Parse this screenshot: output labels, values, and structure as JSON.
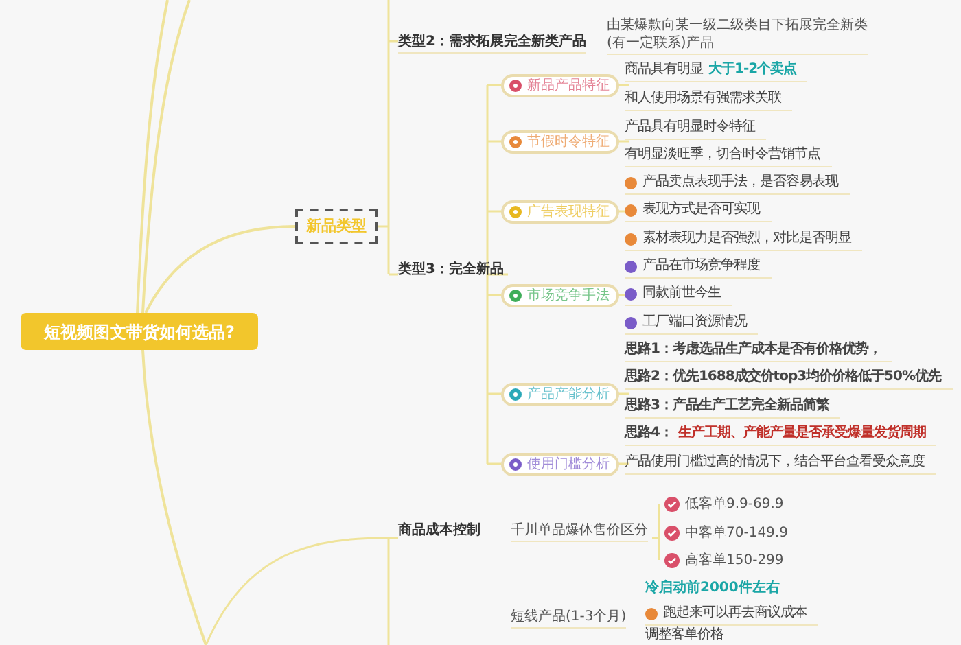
{
  "root": "短视频图文带货如何选品?",
  "new_products": {
    "label": "新品类型",
    "type2": {
      "label": "类型2：需求拓展完全新类产品",
      "note": "由某爆款向某一级二级类目下拓展完全新类(有一定联系)产品"
    },
    "type3": {
      "label": "类型3：完全新品",
      "features": [
        {
          "label": "新品产品特征",
          "color": "#d9506a",
          "items": [
            {
              "kind": "accent",
              "text": "商品具有明显",
              "highlight": "大于1-2个卖点"
            },
            {
              "kind": "plain",
              "text": "和人使用场景有强需求关联"
            }
          ]
        },
        {
          "label": "节假时令特征",
          "color": "#e8893a",
          "items": [
            {
              "kind": "plain",
              "text": "产品具有明显时令特征"
            },
            {
              "kind": "plain",
              "text": "有明显淡旺季，切合时令营销节点"
            }
          ]
        },
        {
          "label": "广告表现特征",
          "color": "#e8b820",
          "items": [
            {
              "kind": "bullet",
              "color": "#e8893a",
              "text": "产品卖点表现手法，是否容易表现"
            },
            {
              "kind": "bullet",
              "color": "#e8893a",
              "text": "表现方式是否可实现"
            },
            {
              "kind": "bullet",
              "color": "#e8893a",
              "text": "素材表现力是否强烈，对比是否明显"
            }
          ]
        },
        {
          "label": "市场竞争手法",
          "color": "#3fae5a",
          "items": [
            {
              "kind": "bullet",
              "color": "#7a5cc8",
              "text": "产品在市场竞争程度"
            },
            {
              "kind": "bullet",
              "color": "#7a5cc8",
              "text": "同款前世今生"
            },
            {
              "kind": "bullet",
              "color": "#7a5cc8",
              "text": "工厂端口资源情况"
            }
          ]
        },
        {
          "label": "产品产能分析",
          "color": "#2aa8b8",
          "items": [
            {
              "kind": "bold",
              "text": "思路1：考虑选品生产成本是否有价格优势，"
            },
            {
              "kind": "bold",
              "text": "思路2：优先1688成交价top3均价价格低于50%优先"
            },
            {
              "kind": "bold",
              "text": "思路3：产品生产工艺完全新品简繁"
            },
            {
              "kind": "alert",
              "text": "思路4：",
              "highlight": "生产工期、产能产量是否承受爆量发货周期"
            }
          ]
        },
        {
          "label": "使用门槛分析",
          "color": "#7a5cc8",
          "items": [
            {
              "kind": "plain",
              "text": "产品使用门槛过高的情况下，结合平台查看受众意度"
            }
          ]
        }
      ]
    }
  },
  "cost_control": {
    "label": "商品成本控制",
    "price_split": {
      "label": "千川单品爆体售价区分",
      "items": [
        {
          "text": "低客单9.9-69.9",
          "color": "#d9506a"
        },
        {
          "text": "中客单70-149.9",
          "color": "#d9506a"
        },
        {
          "text": "高客单150-299",
          "color": "#d9506a"
        }
      ]
    },
    "short_line": {
      "label": "短线产品(1-3个月)",
      "note": "冷启动前2000件左右",
      "items": [
        {
          "kind": "bullet",
          "color": "#e8893a",
          "text": "跑起来可以再去商议成本"
        },
        {
          "kind": "plain",
          "text": "调整客单价格"
        }
      ]
    }
  }
}
